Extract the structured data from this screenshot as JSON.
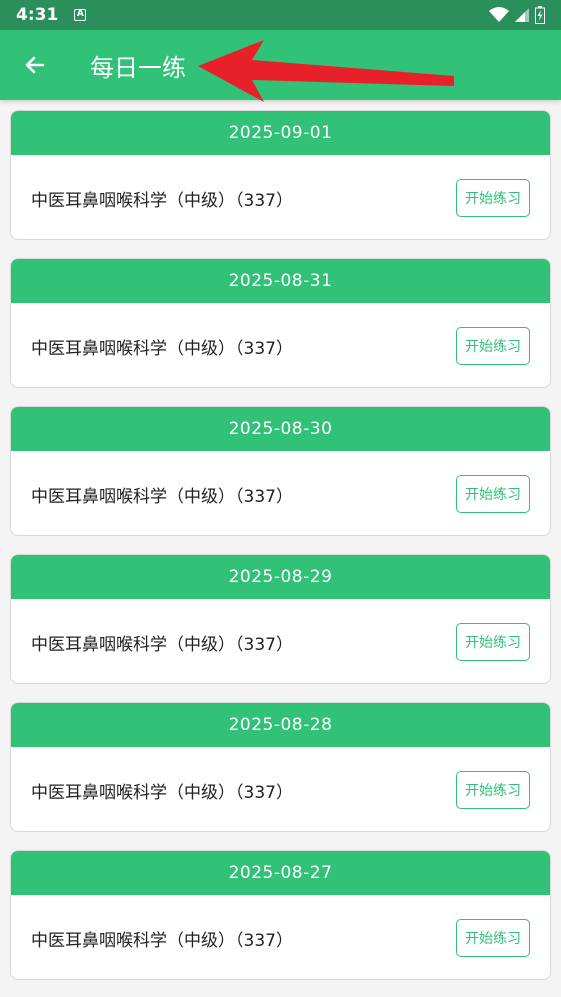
{
  "status_bar": {
    "time": "4:31",
    "notification_glyph": "A"
  },
  "app_bar": {
    "title": "每日一练",
    "back_icon": "arrow-left-icon"
  },
  "annotation": {
    "icon": "red-arrow-annotation",
    "color": "#e8202a"
  },
  "colors": {
    "accent": "#31c177",
    "status_bar": "#2a8f5b"
  },
  "practice_items": [
    {
      "date": "2025-09-01",
      "subject": "中医耳鼻咽喉科学（中级）（337）",
      "button": "开始练习"
    },
    {
      "date": "2025-08-31",
      "subject": "中医耳鼻咽喉科学（中级）（337）",
      "button": "开始练习"
    },
    {
      "date": "2025-08-30",
      "subject": "中医耳鼻咽喉科学（中级）（337）",
      "button": "开始练习"
    },
    {
      "date": "2025-08-29",
      "subject": "中医耳鼻咽喉科学（中级）（337）",
      "button": "开始练习"
    },
    {
      "date": "2025-08-28",
      "subject": "中医耳鼻咽喉科学（中级）（337）",
      "button": "开始练习"
    },
    {
      "date": "2025-08-27",
      "subject": "中医耳鼻咽喉科学（中级）（337）",
      "button": "开始练习"
    }
  ]
}
